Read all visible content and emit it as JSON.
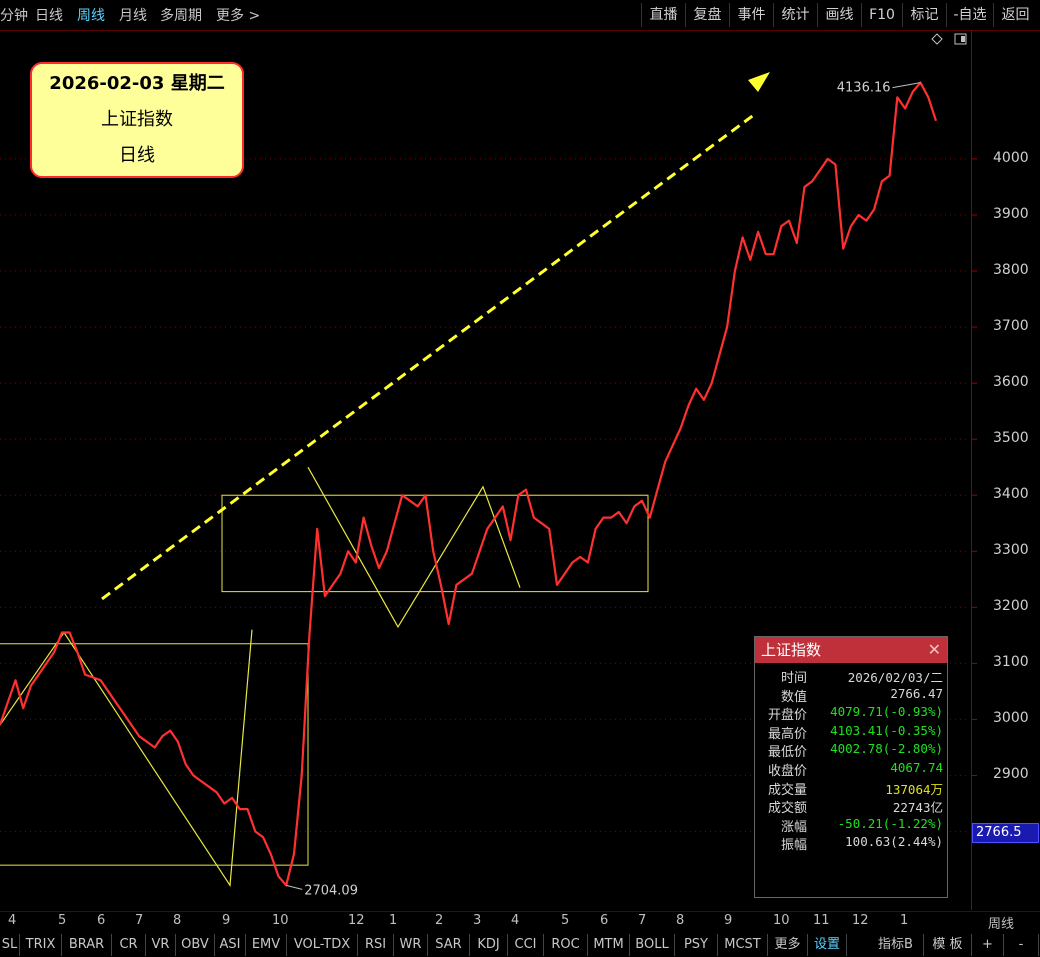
{
  "toolbar": {
    "left": [
      "分钟",
      "日线",
      "周线",
      "月线",
      "多周期",
      "更多 >"
    ],
    "active": "周线",
    "right": [
      "直播",
      "复盘",
      "事件",
      "统计",
      "画线",
      "F10",
      "标记",
      "-自选",
      "返回"
    ]
  },
  "info_box": {
    "date": "2026-02-03 星期二",
    "name": "上证指数",
    "period": "日线"
  },
  "panel": {
    "title": "上证指数",
    "rows": [
      {
        "label": "时间",
        "value": "2026/02/03/二",
        "color": "#d8d8d8"
      },
      {
        "label": "数值",
        "value": "2766.47",
        "color": "#d8d8d8"
      },
      {
        "label": "开盘价",
        "value": "4079.71(-0.93%)",
        "color": "#20e020"
      },
      {
        "label": "最高价",
        "value": "4103.41(-0.35%)",
        "color": "#20e020"
      },
      {
        "label": "最低价",
        "value": "4002.78(-2.80%)",
        "color": "#20e020"
      },
      {
        "label": "收盘价",
        "value": "4067.74",
        "color": "#20e020"
      },
      {
        "label": "成交量",
        "value": "137064万",
        "color": "#e0e020"
      },
      {
        "label": "成交额",
        "value": "22743亿",
        "color": "#d8d8d8"
      },
      {
        "label": "涨幅",
        "value": "-50.21(-1.22%)",
        "color": "#20e020"
      },
      {
        "label": "振幅",
        "value": "100.63(2.44%)",
        "color": "#d8d8d8"
      }
    ]
  },
  "cursor_price": "2766.5",
  "bottom_ticks": [
    "4",
    "5",
    "6",
    "7",
    "8",
    "9",
    "10",
    "12",
    "1",
    "2",
    "3",
    "4",
    "5",
    "6",
    "7",
    "8",
    "9",
    "10",
    "11",
    "12",
    "1"
  ],
  "bottom_right_label": "周线",
  "indicators": [
    "SL",
    "TRIX",
    "BRAR",
    "CR",
    "VR",
    "OBV",
    "ASI",
    "EMV",
    "VOL-TDX",
    "RSI",
    "WR",
    "SAR",
    "KDJ",
    "CCI",
    "ROC",
    "MTM",
    "BOLL",
    "PSY",
    "MCST",
    "更多",
    "设置",
    "指标B",
    "模 板",
    "+",
    "-"
  ],
  "chart_data": {
    "type": "line",
    "series": [
      {
        "values": [
          2990,
          3030,
          3070,
          3020,
          3060,
          3080,
          3100,
          3120,
          3155,
          3155,
          3120,
          3080,
          3075,
          3070,
          3050,
          3030,
          3010,
          2990,
          2970,
          2960,
          2950,
          2970,
          2980,
          2960,
          2920,
          2900,
          2890,
          2880,
          2870,
          2850,
          2860,
          2840,
          2840,
          2800,
          2790,
          2760,
          2720,
          2704,
          2760,
          2900,
          3150,
          3340,
          3220,
          3240,
          3260,
          3300,
          3280,
          3360,
          3310,
          3270,
          3300,
          3350,
          3400,
          3390,
          3380,
          3400,
          3300,
          3240,
          3170,
          3240,
          3250,
          3260,
          3300,
          3340,
          3360,
          3380,
          3320,
          3400,
          3410,
          3360,
          3350,
          3340,
          3240,
          3260,
          3280,
          3290,
          3280,
          3340,
          3360,
          3360,
          3370,
          3350,
          3380,
          3390,
          3360,
          3410,
          3460,
          3490,
          3520,
          3560,
          3590,
          3570,
          3600,
          3650,
          3700,
          3800,
          3860,
          3820,
          3870,
          3830,
          3830,
          3880,
          3890,
          3850,
          3950,
          3960,
          3980,
          4000,
          3990,
          3840,
          3880,
          3900,
          3890,
          3910,
          3960,
          3970,
          4110,
          4090,
          4120,
          4136.16,
          4110,
          4068
        ]
      }
    ],
    "y_ticks": [
      2900,
      3000,
      3100,
      3200,
      3300,
      3400,
      3500,
      3600,
      3700,
      3800,
      3900,
      4000
    ],
    "y_tick_labels": [
      "2900",
      "3000",
      "3100",
      "3200",
      "3300",
      "3400",
      "3500",
      "3600",
      "3700",
      "3800",
      "3900",
      "4000"
    ],
    "ylim": [
      2660,
      4230
    ],
    "annotations": {
      "high_label": "4136.16",
      "low_label": "2704.09"
    },
    "colors": {
      "line": "#ff3030",
      "box": "#e8e840",
      "zigzag": "#e8e840",
      "arrow": "#ffff30",
      "grid": "#7a0000"
    },
    "grid": true
  }
}
